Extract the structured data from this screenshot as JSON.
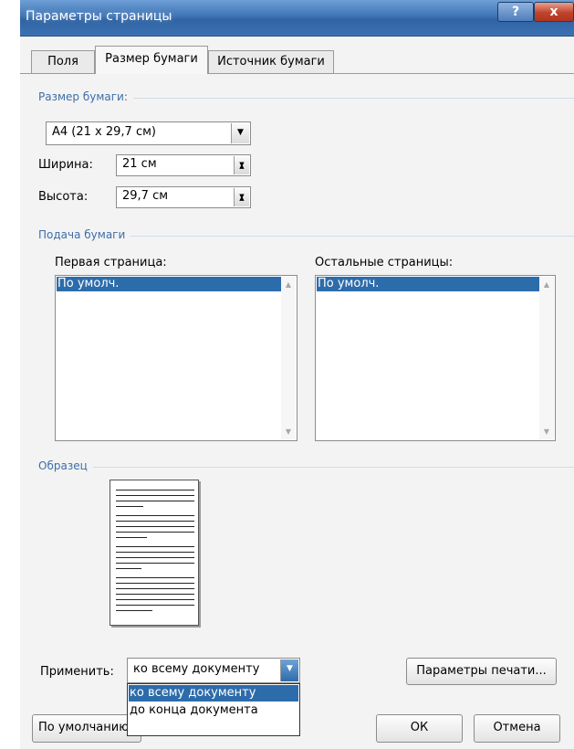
{
  "window": {
    "title": "Параметры страницы",
    "help_button": "?",
    "close_button": "x"
  },
  "tabs": [
    {
      "label": "Поля"
    },
    {
      "label": "Размер бумаги"
    },
    {
      "label": "Источник бумаги"
    }
  ],
  "paper_size": {
    "group_label": "Размер бумаги:",
    "selected": "A4 (21 x 29,7 см)",
    "width_label": "Ширина:",
    "width_value": "21 см",
    "height_label": "Высота:",
    "height_value": "29,7 см"
  },
  "paper_feed": {
    "group_label": "Подача бумаги",
    "first_page_label": "Первая страница:",
    "first_page_selected": "По умолч.",
    "other_pages_label": "Остальные страницы:",
    "other_pages_selected": "По умолч."
  },
  "sample": {
    "group_label": "Образец"
  },
  "apply": {
    "label": "Применить:",
    "selected": "ко всему документу",
    "options": [
      "ко всему документу",
      "до конца документа"
    ]
  },
  "buttons": {
    "print_options": "Параметры печати...",
    "default": "По умолчанию",
    "ok": "ОК",
    "cancel": "Отмена"
  },
  "colors": {
    "accent": "#3e6ea8",
    "selection": "#2d6cab",
    "title_bar": "#3f75b5",
    "close_button": "#c0432c"
  }
}
